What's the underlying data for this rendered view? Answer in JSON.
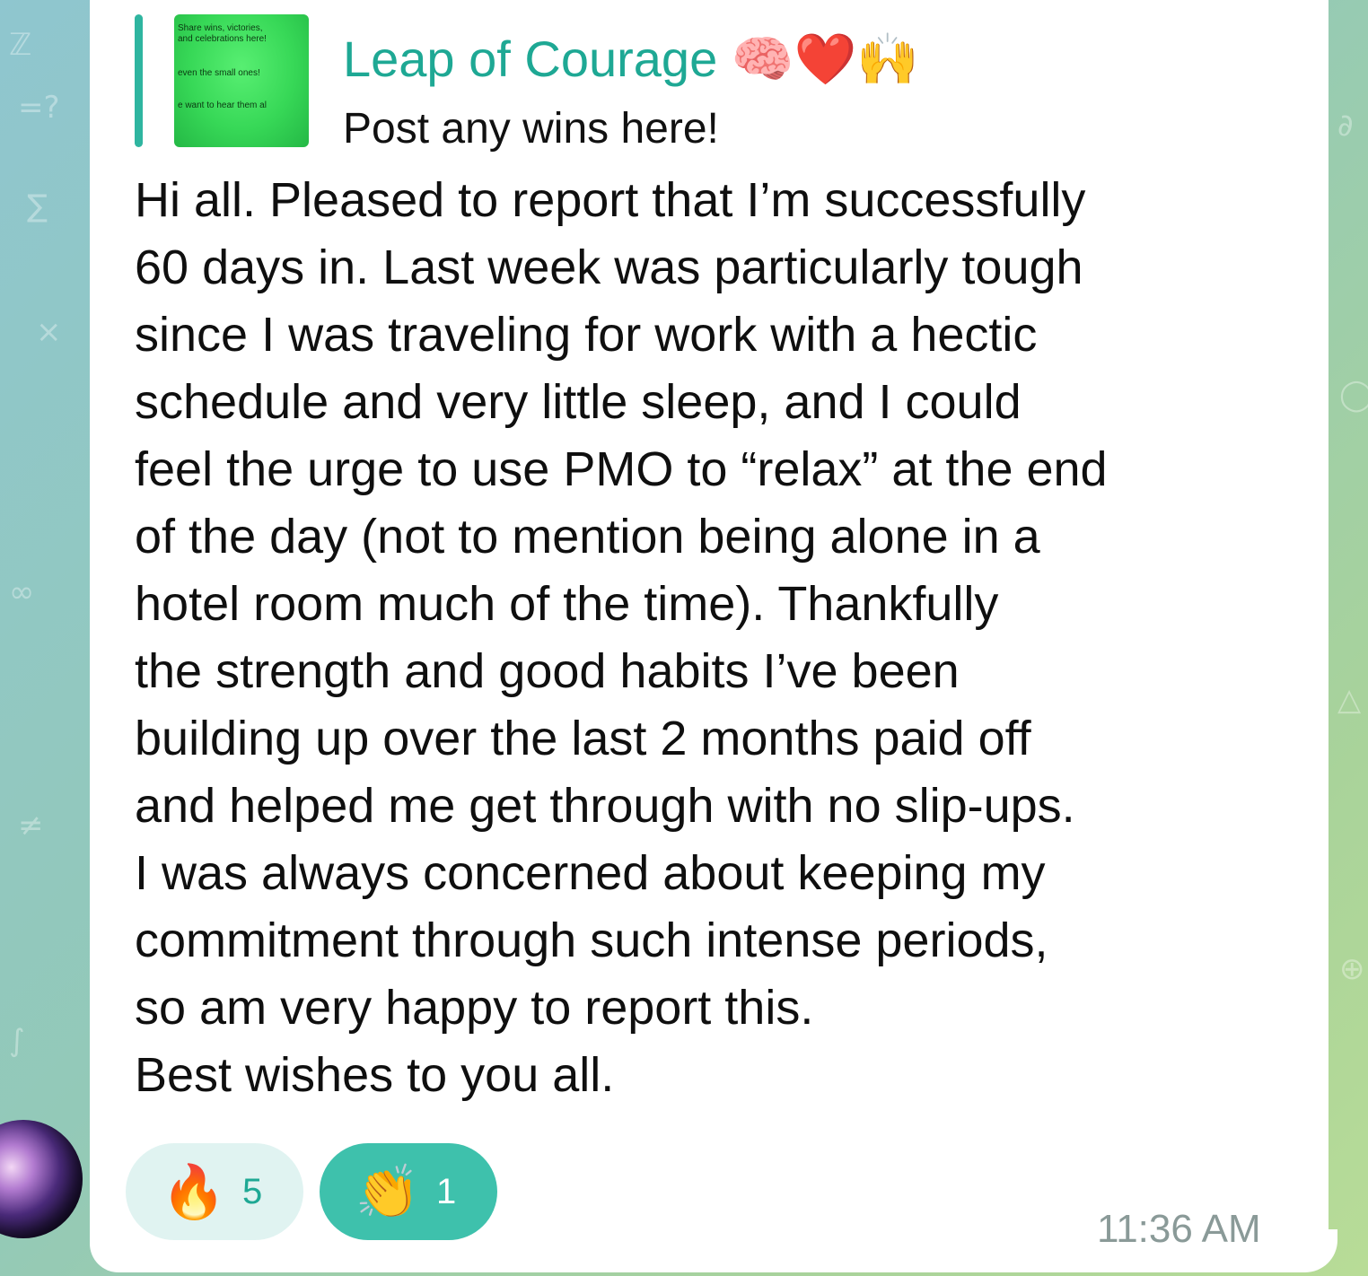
{
  "reply": {
    "thumbnail_lines": [
      "Share wins, victories,",
      "and celebrations here!",
      "even the small ones!",
      "e want to hear them al"
    ],
    "title": "Leap of Courage",
    "title_emojis": "🧠❤️🙌",
    "subtitle": "Post any wins here!"
  },
  "message": {
    "lines": [
      "Hi all. Pleased to report that I’m successfully",
      "60 days in. Last week was particularly tough",
      "since I was traveling for work with a hectic",
      "schedule and very little sleep, and I could",
      "feel the urge to use PMO to “relax” at the end",
      "of the day (not to mention being alone in a",
      "hotel room much of the time). Thankfully",
      "the strength and good habits I’ve been",
      "building up over the last 2 months paid off",
      "and helped me get through with no slip-ups.",
      "I was always concerned about keeping my",
      "commitment through such intense periods,",
      "so am very happy to report this.",
      "Best wishes to you all."
    ]
  },
  "reactions": [
    {
      "emoji": "🔥",
      "icon": "fire-icon",
      "count": "5",
      "selected": false
    },
    {
      "emoji": "👏",
      "icon": "clapping-hands-icon",
      "count": "1",
      "selected": true
    }
  ],
  "timestamp": "11:36 AM",
  "colors": {
    "accent": "#1ea894",
    "reaction_selected": "#3ec1ac",
    "reaction_unselected": "#e0f3f1",
    "timestamp": "#8a9a98"
  }
}
